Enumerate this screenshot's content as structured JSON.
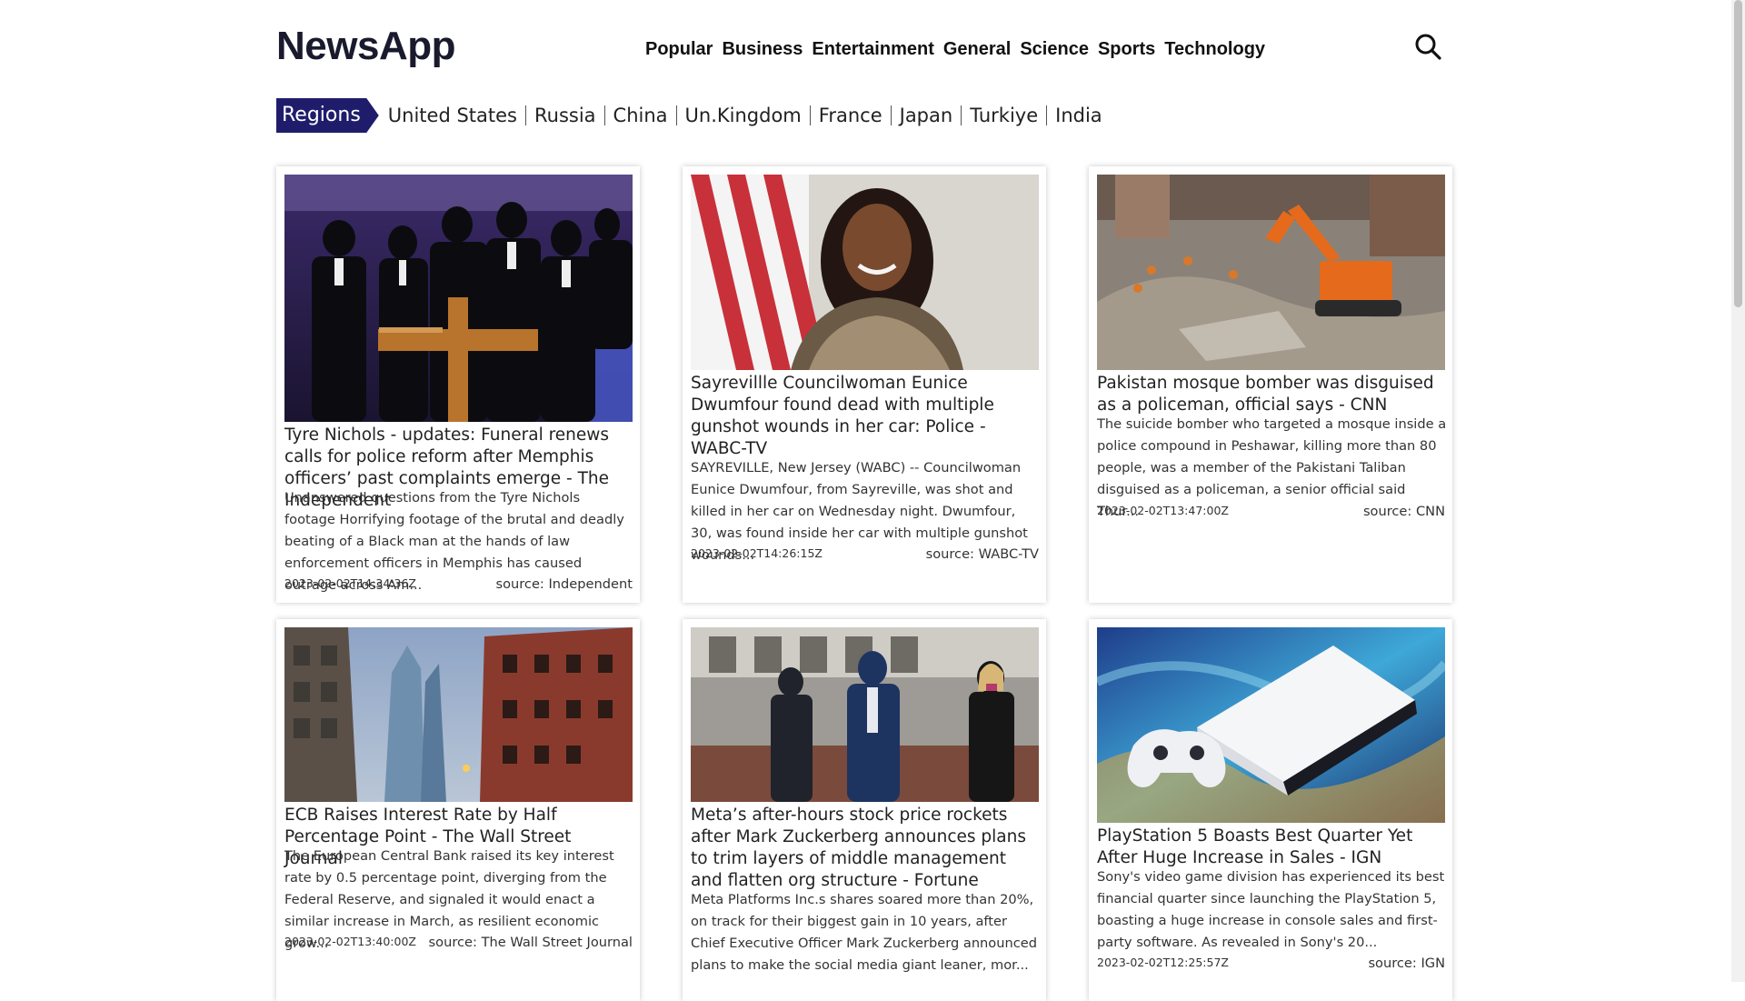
{
  "app": {
    "brand": "NewsApp"
  },
  "nav": [
    "Popular",
    "Business",
    "Entertainment",
    "General",
    "Science",
    "Sports",
    "Technology"
  ],
  "regions": {
    "label": "Regions",
    "items": [
      "United States",
      "Russia",
      "China",
      "Un.Kingdom",
      "France",
      "Japan",
      "Turkiye",
      "India"
    ]
  },
  "articles": [
    {
      "title": "Tyre Nichols - updates: Funeral renews calls for police reform after Memphis officers’ past complaints emerge - The Independent",
      "description": "Unanswered questions from the Tyre Nichols footage Horrifying footage of the brutal and deadly beating of a Black man at the hands of law enforcement officers in Memphis has caused outrage across Am...",
      "date": "2023-02-02T14:34:36Z",
      "source": "source: Independent"
    },
    {
      "title": "Sayrevillle Councilwoman Eunice Dwumfour found dead with multiple gunshot wounds in her car: Police - WABC-TV",
      "description": "SAYREVILLE, New Jersey (WABC) -- Councilwoman Eunice Dwumfour, from Sayreville, was shot and killed in her car on Wednesday night. Dwumfour, 30, was found inside her car with multiple gunshot wounds...",
      "date": "2023-02-02T14:26:15Z",
      "source": "source: WABC-TV"
    },
    {
      "title": "Pakistan mosque bomber was disguised as a policeman, official says - CNN",
      "description": "The suicide bomber who targeted a mosque inside a police compound in Peshawar, killing more than 80 people, was a member of the Pakistani Taliban disguised as a policeman, a senior official said Thur...",
      "date": "2023-02-02T13:47:00Z",
      "source": "source: CNN"
    },
    {
      "title": "ECB Raises Interest Rate by Half Percentage Point - The Wall Street Journal",
      "description": "The European Central Bank raised its key interest rate by 0.5 percentage point, diverging from the Federal Reserve, and signaled it would enact a similar increase in March, as resilient economic grow...",
      "date": "2023-02-02T13:40:00Z",
      "source": "source: The Wall Street Journal"
    },
    {
      "title": "Meta’s after-hours stock price rockets after Mark Zuckerberg announces plans to trim layers of middle management and flatten org structure - Fortune",
      "description": "Meta Platforms Inc.s shares soared more than 20%, on track for their biggest gain in 10 years, after Chief Executive Officer Mark Zuckerberg announced plans to make the social media giant leaner, mor...",
      "date": "",
      "source": ""
    },
    {
      "title": "PlayStation 5 Boasts Best Quarter Yet After Huge Increase in Sales - IGN",
      "description": "Sony's video game division has experienced its best financial quarter since launching the PlayStation 5, boasting a huge increase in console sales and first-party software. As revealed in Sony's 20...",
      "date": "2023-02-02T12:25:57Z",
      "source": "source: IGN"
    }
  ],
  "colors": {
    "regions_tag": "#1f1d6b",
    "brand": "#1a1a2e"
  }
}
